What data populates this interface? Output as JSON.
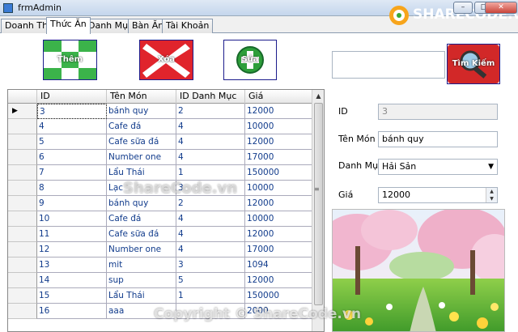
{
  "window": {
    "title": "frmAdmin",
    "minimize": "–",
    "maximize": "□",
    "close": "✕"
  },
  "brand": {
    "text": "SHARECODE.vn"
  },
  "tabs": [
    {
      "label": "Doanh Thu"
    },
    {
      "label": "Thức Ăn"
    },
    {
      "label": "Danh Mục"
    },
    {
      "label": "Bàn Ăn"
    },
    {
      "label": "Tài Khoản"
    }
  ],
  "active_tab": "Thức Ăn",
  "toolbar": {
    "add_label": "Thêm",
    "delete_label": "Xóa",
    "edit_label": "Sửa",
    "search_label": "Tìm Kiếm",
    "search_value": ""
  },
  "grid": {
    "columns": [
      "ID",
      "Tên Món",
      "ID Danh Mục",
      "Giá"
    ],
    "rows": [
      [
        "3",
        "bánh quy",
        "2",
        "12000"
      ],
      [
        "4",
        "Cafe đá",
        "4",
        "10000"
      ],
      [
        "5",
        "Cafe sữa đá",
        "4",
        "12000"
      ],
      [
        "6",
        "Number one",
        "4",
        "17000"
      ],
      [
        "7",
        "Lẩu Thái",
        "1",
        "150000"
      ],
      [
        "8",
        "Lạc",
        "3",
        "10000"
      ],
      [
        "9",
        "bánh quy",
        "2",
        "12000"
      ],
      [
        "10",
        "Cafe đá",
        "4",
        "10000"
      ],
      [
        "11",
        "Cafe sữa đá",
        "4",
        "12000"
      ],
      [
        "12",
        "Number one",
        "4",
        "17000"
      ],
      [
        "13",
        "mit",
        "3",
        "1094"
      ],
      [
        "14",
        "sup",
        "5",
        "12000"
      ],
      [
        "15",
        "Lẩu Thái",
        "1",
        "150000"
      ],
      [
        "16",
        "aaa",
        "",
        "2000"
      ]
    ],
    "selected_row": 0,
    "grip": "≡"
  },
  "form": {
    "id_label": "ID",
    "id_value": "3",
    "name_label": "Tên Món",
    "name_value": "bánh quy",
    "category_label": "Danh Mục",
    "category_value": "Hải Sản",
    "price_label": "Giá",
    "price_value": "12000"
  },
  "watermark": {
    "center": "ShareCode.vn",
    "bottom": "Copyright © ShareCode.vn"
  },
  "colors": {
    "accent": "#1c1c8c",
    "cell_text": "#123c8c",
    "add_green": "#3bb34a",
    "delete_red": "#e0242c"
  }
}
